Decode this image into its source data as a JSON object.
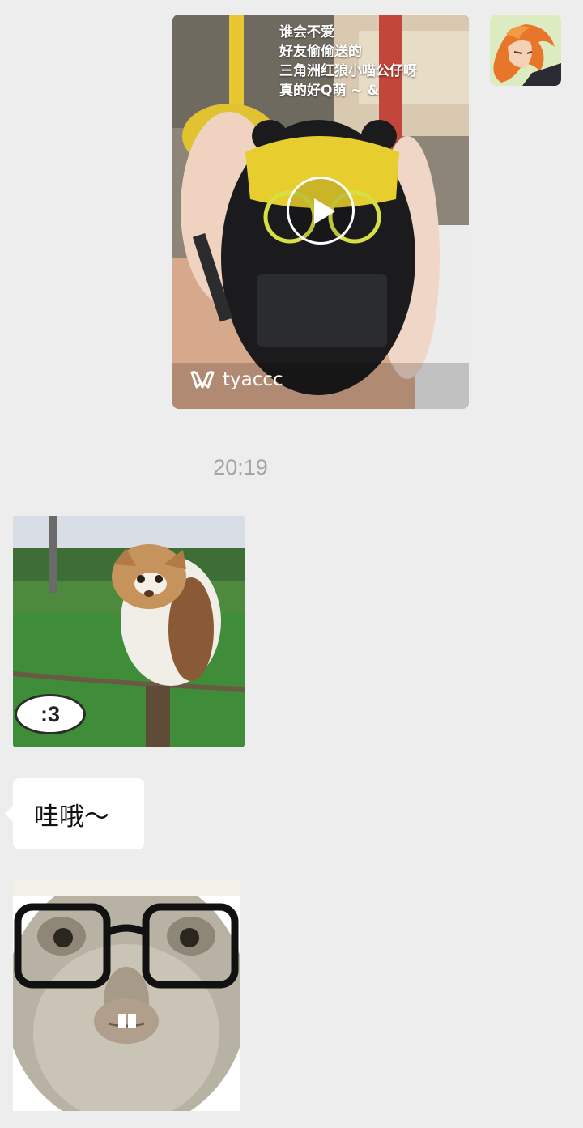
{
  "video_message": {
    "caption_lines": [
      "谁会不爱",
      "好友偷偷送的",
      "三角洲红狼小喵公仔呀",
      "真的好Q萌 ~ &"
    ],
    "watermark": "tyaccc",
    "play_icon": "play-icon"
  },
  "timestamp": "20:19",
  "sticker_cat": {
    "speech_text": ":3"
  },
  "text_bubble": {
    "text": "哇哦～"
  },
  "colors": {
    "background": "#ededed",
    "bubble": "#ffffff",
    "timestamp": "#a5a5a5"
  }
}
